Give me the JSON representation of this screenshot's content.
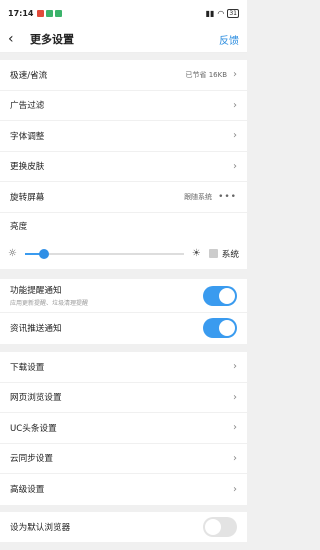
{
  "status": {
    "time": "17:14",
    "battery": "31"
  },
  "header": {
    "title": "更多设置",
    "feedback": "反馈"
  },
  "group1": [
    {
      "label": "极速/省流",
      "value": "已节省 16KB"
    },
    {
      "label": "广告过滤"
    },
    {
      "label": "字体调整"
    },
    {
      "label": "更换皮肤"
    },
    {
      "label": "旋转屏幕",
      "value": "跟随系统"
    }
  ],
  "brightness": {
    "label": "亮度",
    "system_label": "系统",
    "level_percent": 12
  },
  "notify": [
    {
      "label": "功能提醒通知",
      "sub": "应用更新提醒、垃圾清理提醒",
      "on": true
    },
    {
      "label": "资讯推送通知",
      "on": true
    }
  ],
  "group2": [
    {
      "label": "下载设置"
    },
    {
      "label": "网页浏览设置"
    },
    {
      "label": "UC头条设置"
    },
    {
      "label": "云同步设置"
    },
    {
      "label": "高级设置"
    }
  ],
  "default_browser": {
    "label": "设为默认浏览器",
    "on": false
  }
}
